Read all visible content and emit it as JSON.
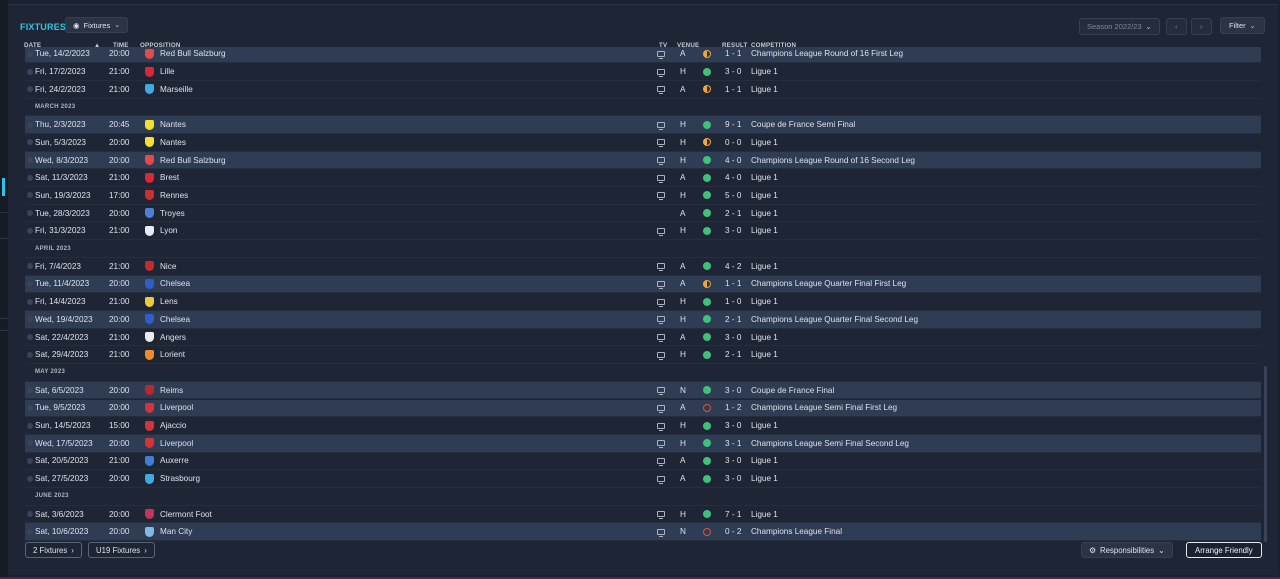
{
  "header": {
    "title": "FIXTURES",
    "view_label": "Fixtures",
    "season_label": "Season 2022/23",
    "filter_label": "Filter"
  },
  "columns": {
    "date": "DATE",
    "time": "TIME",
    "opposition": "OPPOSITION",
    "tv": "TV",
    "venue": "VENUE",
    "result": "RESULT",
    "competition": "COMPETITION"
  },
  "rows": [
    {
      "kind": "fixture",
      "date": "Tue, 14/2/2023",
      "time": "20:00",
      "opp": "Red Bull Salzburg",
      "tv": true,
      "venue": "A",
      "outcome": "D",
      "score": "1 - 1",
      "comp": "Champions League Round of 16 First Leg",
      "hl": true,
      "crest": "#e34b4b"
    },
    {
      "kind": "fixture",
      "date": "Fri, 17/2/2023",
      "time": "21:00",
      "opp": "Lille",
      "tv": true,
      "venue": "H",
      "outcome": "W",
      "score": "3 - 0",
      "comp": "Ligue 1",
      "hl": false,
      "crest": "#d9283a"
    },
    {
      "kind": "fixture",
      "date": "Fri, 24/2/2023",
      "time": "21:00",
      "opp": "Marseille",
      "tv": true,
      "venue": "A",
      "outcome": "D",
      "score": "1 - 1",
      "comp": "Ligue 1",
      "hl": false,
      "crest": "#3fa9e0"
    },
    {
      "kind": "month",
      "label": "MARCH 2023"
    },
    {
      "kind": "fixture",
      "date": "Thu, 2/3/2023",
      "time": "20:45",
      "opp": "Nantes",
      "tv": true,
      "venue": "H",
      "outcome": "W",
      "score": "9 - 1",
      "comp": "Coupe de France Semi Final",
      "hl": true,
      "crest": "#f2e12a"
    },
    {
      "kind": "fixture",
      "date": "Sun, 5/3/2023",
      "time": "20:00",
      "opp": "Nantes",
      "tv": true,
      "venue": "H",
      "outcome": "D",
      "score": "0 - 0",
      "comp": "Ligue 1",
      "hl": false,
      "crest": "#f2e12a"
    },
    {
      "kind": "fixture",
      "date": "Wed, 8/3/2023",
      "time": "20:00",
      "opp": "Red Bull Salzburg",
      "tv": true,
      "venue": "H",
      "outcome": "W",
      "score": "4 - 0",
      "comp": "Champions League Round of 16 Second Leg",
      "hl": true,
      "crest": "#e34b4b"
    },
    {
      "kind": "fixture",
      "date": "Sat, 11/3/2023",
      "time": "21:00",
      "opp": "Brest",
      "tv": true,
      "venue": "A",
      "outcome": "W",
      "score": "4 - 0",
      "comp": "Ligue 1",
      "hl": false,
      "crest": "#d9283a"
    },
    {
      "kind": "fixture",
      "date": "Sun, 19/3/2023",
      "time": "17:00",
      "opp": "Rennes",
      "tv": true,
      "venue": "H",
      "outcome": "W",
      "score": "5 - 0",
      "comp": "Ligue 1",
      "hl": false,
      "crest": "#c8312f"
    },
    {
      "kind": "fixture",
      "date": "Tue, 28/3/2023",
      "time": "20:00",
      "opp": "Troyes",
      "tv": false,
      "venue": "A",
      "outcome": "W",
      "score": "2 - 1",
      "comp": "Ligue 1",
      "hl": false,
      "crest": "#4f7fd3"
    },
    {
      "kind": "fixture",
      "date": "Fri, 31/3/2023",
      "time": "21:00",
      "opp": "Lyon",
      "tv": true,
      "venue": "H",
      "outcome": "W",
      "score": "3 - 0",
      "comp": "Ligue 1",
      "hl": false,
      "crest": "#e8ecf2"
    },
    {
      "kind": "month",
      "label": "APRIL 2023"
    },
    {
      "kind": "fixture",
      "date": "Fri, 7/4/2023",
      "time": "21:00",
      "opp": "Nice",
      "tv": true,
      "venue": "A",
      "outcome": "W",
      "score": "4 - 2",
      "comp": "Ligue 1",
      "hl": false,
      "crest": "#c42b2b"
    },
    {
      "kind": "fixture",
      "date": "Tue, 11/4/2023",
      "time": "20:00",
      "opp": "Chelsea",
      "tv": true,
      "venue": "A",
      "outcome": "D",
      "score": "1 - 1",
      "comp": "Champions League Quarter Final First Leg",
      "hl": true,
      "crest": "#2f5ec9"
    },
    {
      "kind": "fixture",
      "date": "Fri, 14/4/2023",
      "time": "21:00",
      "opp": "Lens",
      "tv": true,
      "venue": "H",
      "outcome": "W",
      "score": "1 - 0",
      "comp": "Ligue 1",
      "hl": false,
      "crest": "#f0c93a"
    },
    {
      "kind": "fixture",
      "date": "Wed, 19/4/2023",
      "time": "20:00",
      "opp": "Chelsea",
      "tv": true,
      "venue": "H",
      "outcome": "W",
      "score": "2 - 1",
      "comp": "Champions League Quarter Final Second Leg",
      "hl": true,
      "crest": "#2f5ec9"
    },
    {
      "kind": "fixture",
      "date": "Sat, 22/4/2023",
      "time": "21:00",
      "opp": "Angers",
      "tv": true,
      "venue": "A",
      "outcome": "W",
      "score": "3 - 0",
      "comp": "Ligue 1",
      "hl": false,
      "crest": "#e8ecf2"
    },
    {
      "kind": "fixture",
      "date": "Sat, 29/4/2023",
      "time": "21:00",
      "opp": "Lorient",
      "tv": true,
      "venue": "H",
      "outcome": "W",
      "score": "2 - 1",
      "comp": "Ligue 1",
      "hl": false,
      "crest": "#f08a2a"
    },
    {
      "kind": "month",
      "label": "MAY 2023"
    },
    {
      "kind": "fixture",
      "date": "Sat, 6/5/2023",
      "time": "20:00",
      "opp": "Reims",
      "tv": true,
      "venue": "N",
      "outcome": "W",
      "score": "3 - 0",
      "comp": "Coupe de France Final",
      "hl": true,
      "crest": "#b8282e"
    },
    {
      "kind": "fixture",
      "date": "Tue, 9/5/2023",
      "time": "20:00",
      "opp": "Liverpool",
      "tv": true,
      "venue": "A",
      "outcome": "L",
      "score": "1 - 2",
      "comp": "Champions League Semi Final First Leg",
      "hl": true,
      "crest": "#d3343c"
    },
    {
      "kind": "fixture",
      "date": "Sun, 14/5/2023",
      "time": "15:00",
      "opp": "Ajaccio",
      "tv": true,
      "venue": "H",
      "outcome": "W",
      "score": "3 - 0",
      "comp": "Ligue 1",
      "hl": false,
      "crest": "#d3343c"
    },
    {
      "kind": "fixture",
      "date": "Wed, 17/5/2023",
      "time": "20:00",
      "opp": "Liverpool",
      "tv": true,
      "venue": "H",
      "outcome": "W",
      "score": "3 - 1",
      "comp": "Champions League Semi Final Second Leg",
      "hl": true,
      "crest": "#d3343c"
    },
    {
      "kind": "fixture",
      "date": "Sat, 20/5/2023",
      "time": "21:00",
      "opp": "Auxerre",
      "tv": true,
      "venue": "A",
      "outcome": "W",
      "score": "3 - 0",
      "comp": "Ligue 1",
      "hl": false,
      "crest": "#3f7fd3"
    },
    {
      "kind": "fixture",
      "date": "Sat, 27/5/2023",
      "time": "20:00",
      "opp": "Strasbourg",
      "tv": true,
      "venue": "A",
      "outcome": "W",
      "score": "3 - 0",
      "comp": "Ligue 1",
      "hl": false,
      "crest": "#3fa9e0"
    },
    {
      "kind": "month",
      "label": "JUNE 2023"
    },
    {
      "kind": "fixture",
      "date": "Sat, 3/6/2023",
      "time": "20:00",
      "opp": "Clermont Foot",
      "tv": true,
      "venue": "H",
      "outcome": "W",
      "score": "7 - 1",
      "comp": "Ligue 1",
      "hl": false,
      "crest": "#c4345a"
    },
    {
      "kind": "fixture",
      "date": "Sat, 10/6/2023",
      "time": "20:00",
      "opp": "Man City",
      "tv": true,
      "venue": "N",
      "outcome": "L",
      "score": "0 - 2",
      "comp": "Champions League Final",
      "hl": true,
      "crest": "#7fb9e6"
    }
  ],
  "footer": {
    "fixtures_label": "2 Fixtures",
    "u19_label": "U19 Fixtures",
    "responsibilities_label": "Responsibilities",
    "arrange_label": "Arrange Friendly"
  },
  "icons": {
    "view": "eye-icon",
    "chevron": "chevron-down-icon",
    "tv": "tv-icon",
    "sort": "sort-up-icon"
  }
}
